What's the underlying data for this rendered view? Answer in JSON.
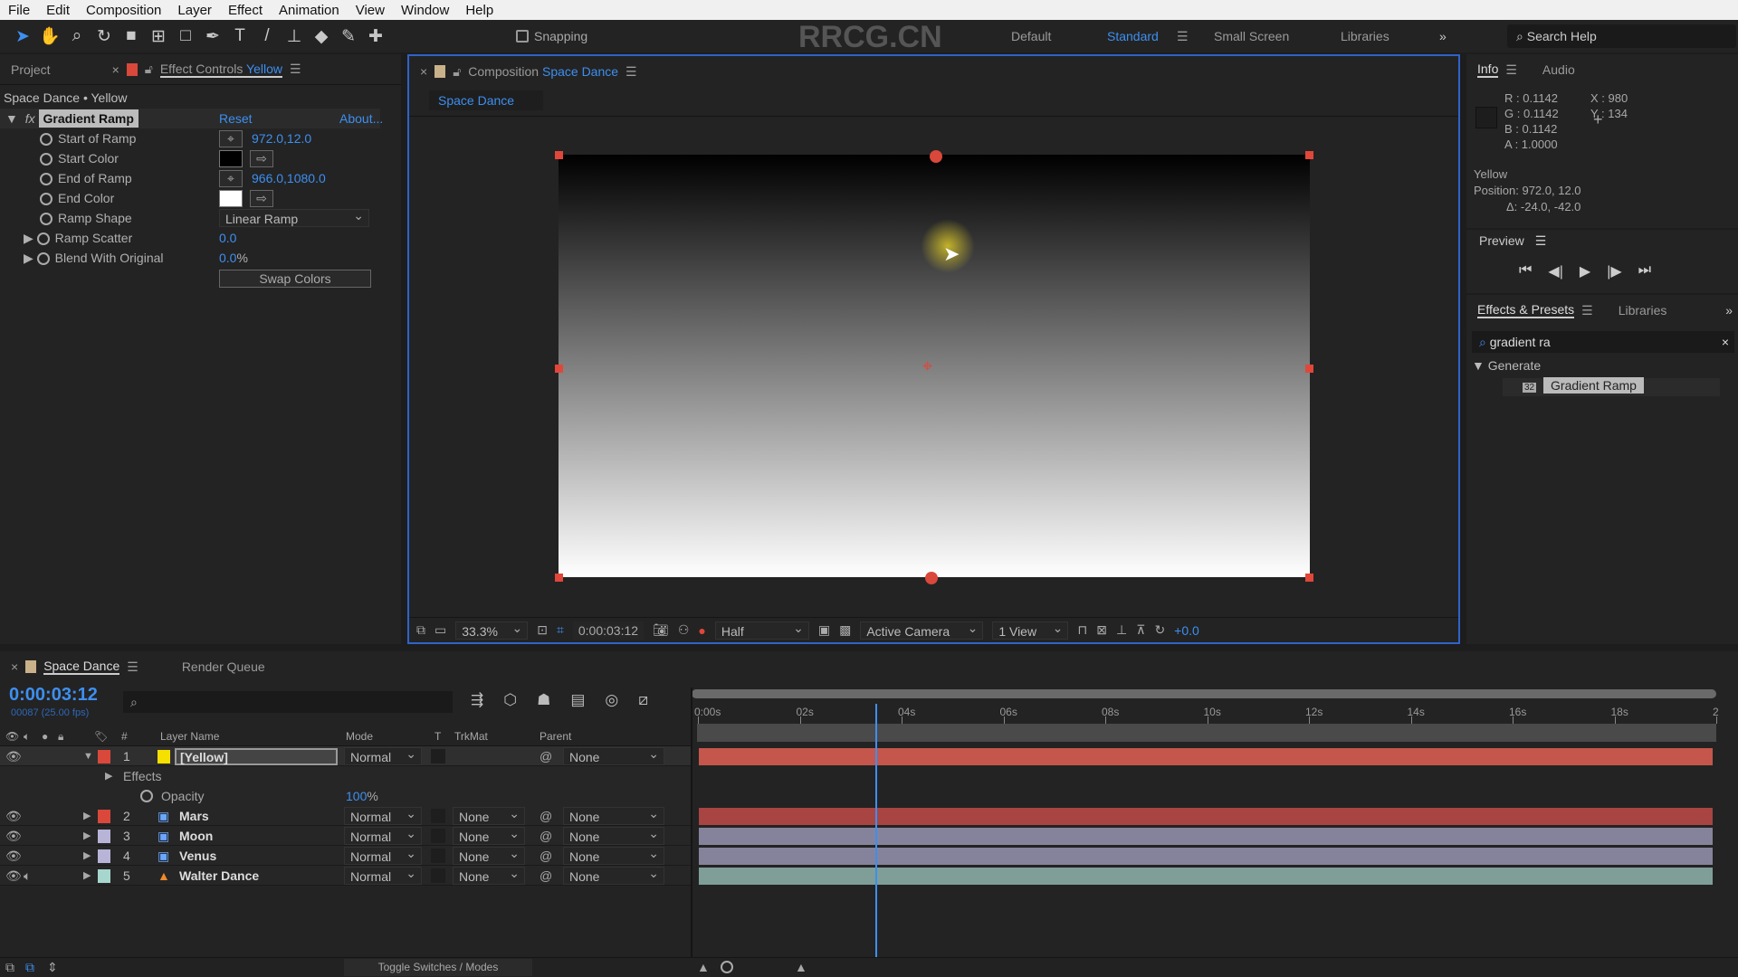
{
  "menu": [
    "File",
    "Edit",
    "Composition",
    "Layer",
    "Effect",
    "Animation",
    "View",
    "Window",
    "Help"
  ],
  "toolbar": {
    "snapping": "Snapping",
    "workspaces": [
      "Default",
      "Standard",
      "Small Screen",
      "Libraries"
    ],
    "active_workspace": "Standard",
    "search_help": "Search Help",
    "watermark": "RRCG.CN"
  },
  "left": {
    "tab_project": "Project",
    "tab_effect_controls": "Effect Controls",
    "layer": "Yellow",
    "breadcrumb": "Space Dance • Yellow",
    "effect_name": "Gradient Ramp",
    "reset": "Reset",
    "about": "About...",
    "props": [
      {
        "label": "Start of Ramp",
        "value": "972.0,12.0"
      },
      {
        "label": "Start Color",
        "color": "#000000"
      },
      {
        "label": "End of Ramp",
        "value": "966.0,1080.0"
      },
      {
        "label": "End Color",
        "color": "#ffffff"
      },
      {
        "label": "Ramp Shape",
        "value": "Linear Ramp"
      },
      {
        "label": "Ramp Scatter",
        "value": "0.0"
      },
      {
        "label": "Blend With Original",
        "value": "0.0",
        "unit": "%"
      }
    ],
    "swap_colors": "Swap Colors"
  },
  "comp": {
    "tab_label": "Composition",
    "comp_name": "Space Dance",
    "sub_tab": "Space Dance",
    "zoom": "33.3%",
    "timecode": "0:00:03:12",
    "resolution": "Half",
    "camera": "Active Camera",
    "views": "1 View",
    "exposure": "+0.0"
  },
  "info": {
    "tab_info": "Info",
    "tab_audio": "Audio",
    "r": "R : 0.1142",
    "g": "G : 0.1142",
    "b": "B : 0.1142",
    "a": "A :  1.0000",
    "x": "X : 980",
    "y": "Y : 134",
    "layer": "Yellow",
    "position": "Position: 972.0, 12.0",
    "delta": "Δ: -24.0, -42.0"
  },
  "preview": {
    "title": "Preview"
  },
  "effects_presets": {
    "tab": "Effects & Presets",
    "tab_libraries": "Libraries",
    "search": "gradient ra",
    "category": "Generate",
    "item": "Gradient Ramp",
    "badge": "32"
  },
  "timeline": {
    "tab": "Space Dance",
    "tab_render": "Render Queue",
    "timecode": "0:00:03:12",
    "frames": "00087 (25.00 fps)",
    "columns": {
      "num": "#",
      "name": "Layer Name",
      "mode": "Mode",
      "t": "T",
      "trkmat": "TrkMat",
      "parent": "Parent"
    },
    "ticks": [
      "0:00s",
      "02s",
      "04s",
      "06s",
      "08s",
      "10s",
      "12s",
      "14s",
      "16s",
      "18s",
      "2"
    ],
    "current_time_s": 3.48,
    "duration_s": 20,
    "layers": [
      {
        "num": "1",
        "name": "[Yellow]",
        "label": "#d9483b",
        "swatch": "#f5e000",
        "mode": "Normal",
        "trkmat": "",
        "parent": "None",
        "bar": "#c4564c"
      },
      {
        "num": "2",
        "name": "Mars",
        "label": "#d9483b",
        "mode": "Normal",
        "trkmat": "None",
        "parent": "None",
        "bar": "#a84442"
      },
      {
        "num": "3",
        "name": "Moon",
        "label": "#b7b4d8",
        "mode": "Normal",
        "trkmat": "None",
        "parent": "None",
        "bar": "#85839b"
      },
      {
        "num": "4",
        "name": "Venus",
        "label": "#b7b4d8",
        "mode": "Normal",
        "trkmat": "None",
        "parent": "None",
        "bar": "#85839b"
      },
      {
        "num": "5",
        "name": "Walter Dance",
        "label": "#a6d6cd",
        "mode": "Normal",
        "trkmat": "None",
        "parent": "None",
        "bar": "#7f9e98"
      }
    ],
    "effects_label": "Effects",
    "opacity_label": "Opacity",
    "opacity_value": "100",
    "opacity_unit": "%",
    "toggle": "Toggle Switches / Modes"
  }
}
